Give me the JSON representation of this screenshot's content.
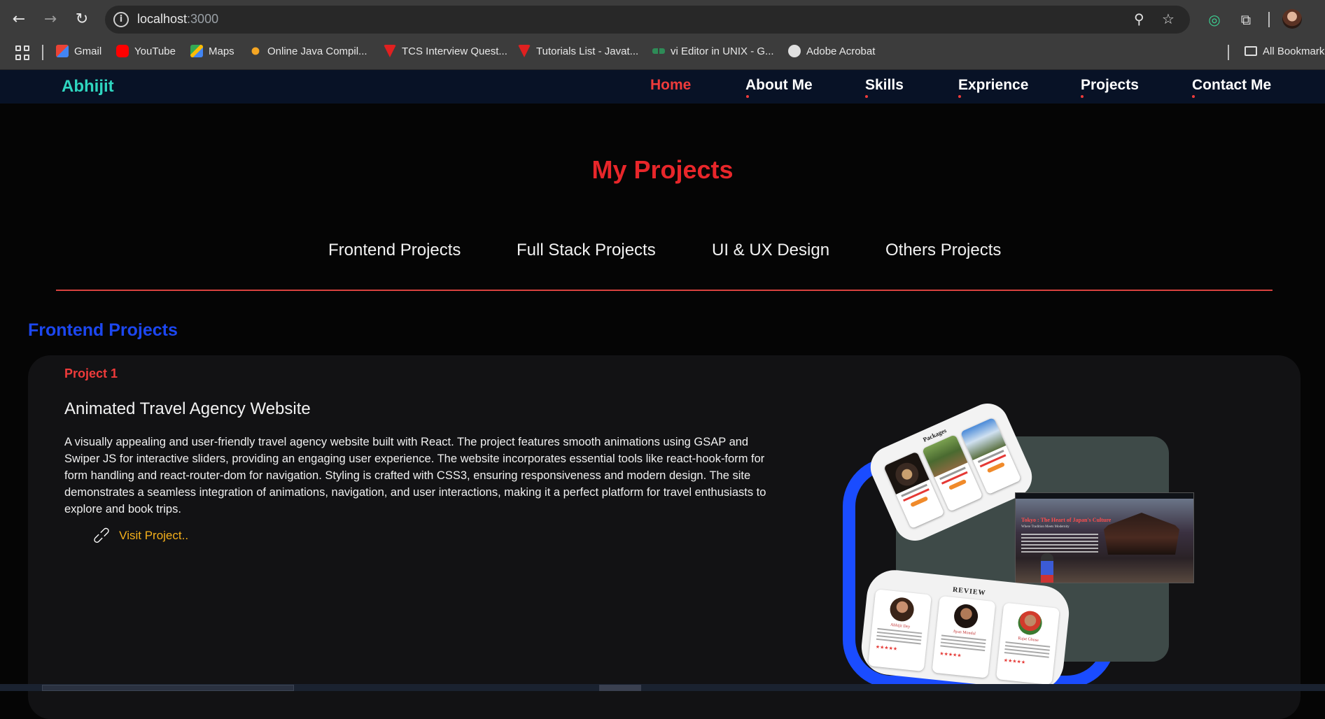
{
  "browser": {
    "url_host": "localhost",
    "url_port": ":3000",
    "bookmarks": [
      {
        "label": "Gmail",
        "color": "#ea4335"
      },
      {
        "label": "YouTube",
        "color": "#ff0000"
      },
      {
        "label": "Maps",
        "color": "#34a853"
      },
      {
        "label": "Online Java Compil...",
        "color": "#f5a623"
      },
      {
        "label": "TCS Interview Quest...",
        "color": "#e02020"
      },
      {
        "label": "Tutorials List - Javat...",
        "color": "#e02020"
      },
      {
        "label": "vi Editor in UNIX - G...",
        "color": "#2e8b57"
      },
      {
        "label": "Adobe Acrobat",
        "color": "#e0e0e0"
      }
    ],
    "all_bookmarks": "All Bookmark"
  },
  "site": {
    "brand": "Abhijit",
    "nav": [
      "Home",
      "About Me",
      "Skills",
      "Exprience",
      "Projects",
      "Contact Me"
    ],
    "accent": "#ef3b3b"
  },
  "projects_page": {
    "title": "My Projects",
    "tabs": [
      "Frontend Projects",
      "Full Stack Projects",
      "UI & UX Design",
      "Others Projects"
    ],
    "category_heading": "Frontend Projects",
    "project": {
      "number": "Project 1",
      "title": "Animated Travel Agency Website",
      "description": "A visually appealing and user-friendly travel agency website built with React. The project features smooth animations using GSAP and Swiper JS for interactive sliders, providing an engaging user experience. The website incorporates essential tools like react-hook-form for form handling and react-router-dom for navigation. Styling is crafted with CSS3, ensuring responsiveness and modern design. The site demonstrates a seamless integration of animations, navigation, and user interactions, making it a perfect platform for travel enthusiasts to explore and book trips.",
      "link_label": "Visit Project..",
      "preview": {
        "packages_label": "Packages",
        "review_label": "REVIEW",
        "reviewers": [
          "Abhijit Dey",
          "Ayan Mondal",
          "Rajat Ghose"
        ],
        "hero_heading": "Tokyo : The Heart of Japan's Culture",
        "hero_sub": "Where Tradition Meets Modernity"
      }
    }
  }
}
